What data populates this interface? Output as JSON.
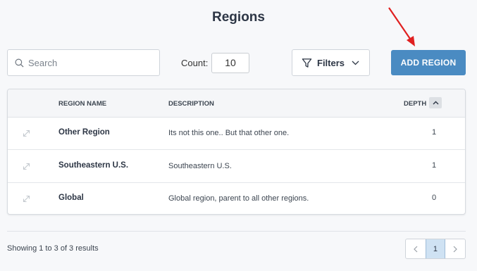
{
  "page": {
    "title": "Regions"
  },
  "toolbar": {
    "search_placeholder": "Search",
    "count_label": "Count:",
    "count_value": "10",
    "filters_label": "Filters",
    "add_button_label": "ADD REGION"
  },
  "table": {
    "columns": {
      "name": "REGION NAME",
      "description": "DESCRIPTION",
      "depth": "DEPTH"
    },
    "rows": [
      {
        "name": "Other Region",
        "description": "Its not this one.. But that other one.",
        "depth": "1"
      },
      {
        "name": "Southeastern U.S.",
        "description": "Southeastern U.S.",
        "depth": "1"
      },
      {
        "name": "Global",
        "description": "Global region, parent to all other regions.",
        "depth": "0"
      }
    ]
  },
  "footer": {
    "showing_text": "Showing 1 to 3 of 3 results",
    "current_page": "1"
  },
  "colors": {
    "accent": "#4a8bc2",
    "annotation_arrow": "#e02020",
    "active_page": "#cfe2f3"
  },
  "icons": {
    "search": "search-icon",
    "filter": "filter-icon",
    "dropdown": "chevron-down-icon",
    "sort": "chevron-up-icon",
    "expand": "expand-arrows-icon",
    "prev": "chevron-left-icon",
    "next": "chevron-right-icon"
  }
}
